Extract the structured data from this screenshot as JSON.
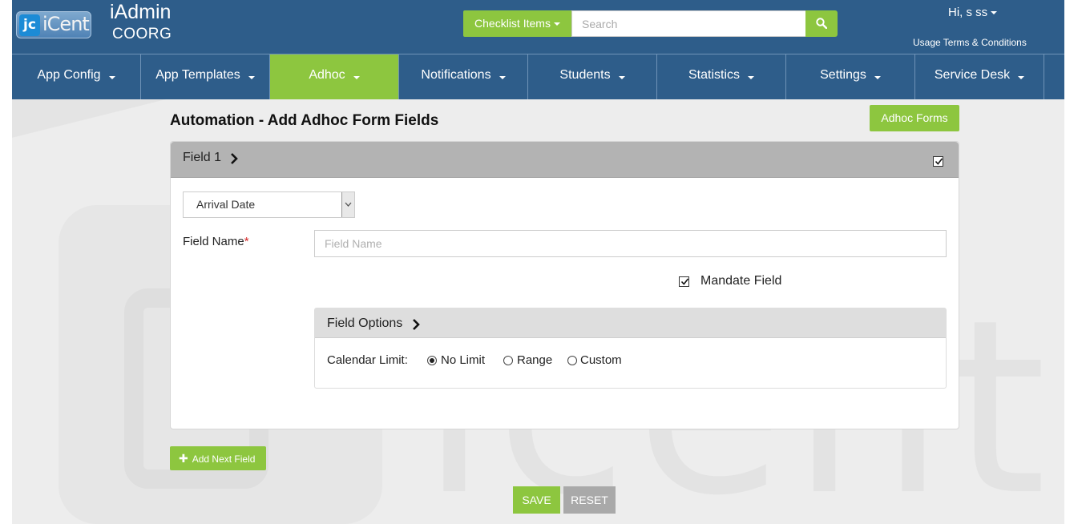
{
  "header": {
    "logo_mark": "jc",
    "logo_word": "iCent",
    "app_title": "iAdmin",
    "org_name": "COORG",
    "checklist_label": "Checklist Items",
    "search_placeholder": "Search",
    "user_greeting": "Hi, s ss",
    "terms_link": "Usage Terms & Conditions"
  },
  "nav": {
    "items": [
      {
        "label": "App Config"
      },
      {
        "label": "App Templates"
      },
      {
        "label": "Adhoc",
        "active": true
      },
      {
        "label": "Notifications"
      },
      {
        "label": "Students"
      },
      {
        "label": "Statistics"
      },
      {
        "label": "Settings"
      },
      {
        "label": "Service Desk"
      }
    ]
  },
  "content": {
    "title": "Automation - Add Adhoc Form Fields",
    "adhoc_forms_button": "Adhoc Forms",
    "field": {
      "title": "Field 1",
      "enabled_checked": true,
      "type_selected": "Arrival Date",
      "name_label": "Field Name",
      "required_marker": "*",
      "name_placeholder": "Field Name",
      "name_value": "",
      "mandate_label": "Mandate Field",
      "mandate_checked": true,
      "options": {
        "title": "Field Options",
        "calendar_limit_label": "Calendar Limit:",
        "radios": [
          {
            "label": "No Limit",
            "checked": true
          },
          {
            "label": "Range",
            "checked": false
          },
          {
            "label": "Custom",
            "checked": false
          }
        ]
      }
    },
    "add_next_label": "Add Next Field",
    "add_next_icon": "plus-icon",
    "save_label": "SAVE",
    "reset_label": "RESET"
  },
  "colors": {
    "header_bg": "#2e5d8a",
    "accent_green": "#8dc63f",
    "reset_gray": "#a9a9a9",
    "panel_head_gray": "#b3b3b3"
  }
}
